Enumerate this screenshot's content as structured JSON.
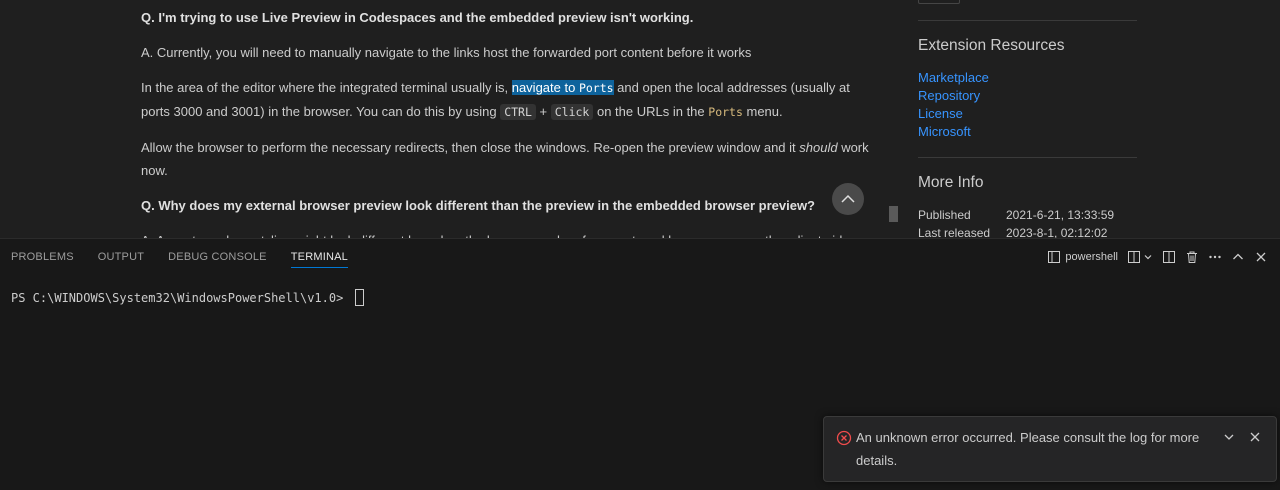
{
  "content": {
    "q1": "Q. I'm trying to use Live Preview in Codespaces and the embedded preview isn't working.",
    "a1": "A. Currently, you will need to manually navigate to the links host the forwarded port content before it works",
    "p2_before": "In the area of the editor where the integrated terminal usually is, ",
    "p2_hl_text": "navigate to ",
    "p2_hl_code": "Ports",
    "p2_mid": " and open the local addresses (usually at ports 3000 and 3001) in the browser. You can do this by using ",
    "p2_code1": "CTRL",
    "p2_plus": " + ",
    "p2_code2": "Click",
    "p2_mid2": " on the URLs in the ",
    "p2_code3": "Ports",
    "p2_end": " menu.",
    "p3_before": "Allow the browser to perform the necessary redirects, then close the windows. Re-open the preview window and it ",
    "p3_em": "should",
    "p3_after": " work now.",
    "q2": "Q. Why does my external browser preview look different than the preview in the embedded browser preview?",
    "a2": "A. Aspects such as styling might look different based on the browser cache of your external browser or any other client-side"
  },
  "sidebar": {
    "resources_title": "Extension Resources",
    "links": [
      "Marketplace",
      "Repository",
      "License",
      "Microsoft"
    ],
    "more_info_title": "More Info",
    "info": [
      {
        "key": "Published",
        "value": "2021-6-21, 13:33:59"
      },
      {
        "key": "Last released",
        "value": "2023-8-1, 02:12:02"
      }
    ]
  },
  "panel": {
    "tabs": [
      "PROBLEMS",
      "OUTPUT",
      "DEBUG CONSOLE",
      "TERMINAL"
    ],
    "active_tab": "TERMINAL",
    "shell_label": "powershell",
    "terminal_prompt": "PS C:\\WINDOWS\\System32\\WindowsPowerShell\\v1.0> "
  },
  "notification": {
    "message": "An unknown error occurred. Please consult the log for more details.",
    "error_color": "#f14c4c"
  },
  "colors": {
    "link": "#3794ff",
    "accent": "#0078d4",
    "highlight": "#0e639c"
  }
}
